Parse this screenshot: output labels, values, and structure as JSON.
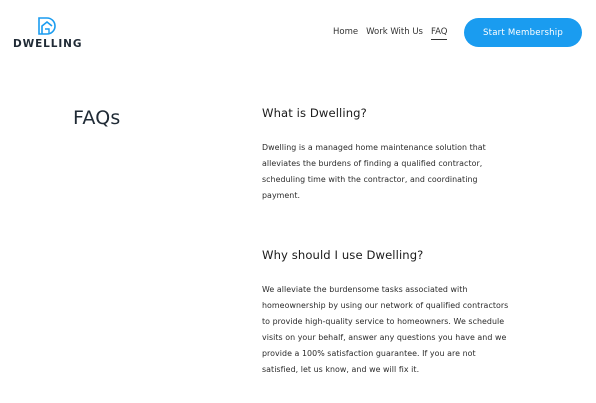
{
  "brand": {
    "name": "DWELLING",
    "accent": "#1a9cf0",
    "logo_icon": "dwelling-house-d-icon"
  },
  "nav": {
    "items": [
      {
        "label": "Home",
        "active": false
      },
      {
        "label": "Work With Us",
        "active": false
      },
      {
        "label": "FAQ",
        "active": true
      }
    ],
    "cta_label": "Start Membership"
  },
  "main": {
    "title": "FAQs",
    "faqs": [
      {
        "question": "What is Dwelling?",
        "answer": "Dwelling is a managed home maintenance solution that alleviates the burdens of finding a qualified contractor, scheduling time with the contractor, and coordinating payment."
      },
      {
        "question": "Why should I use Dwelling?",
        "answer": "We alleviate the burdensome tasks associated with homeownership by using our network of qualified contractors to provide high-quality service to homeowners. We schedule visits on your behalf, answer any questions you have and we provide a 100% satisfaction guarantee. If you are not satisfied, let us know, and we will fix it."
      }
    ]
  }
}
